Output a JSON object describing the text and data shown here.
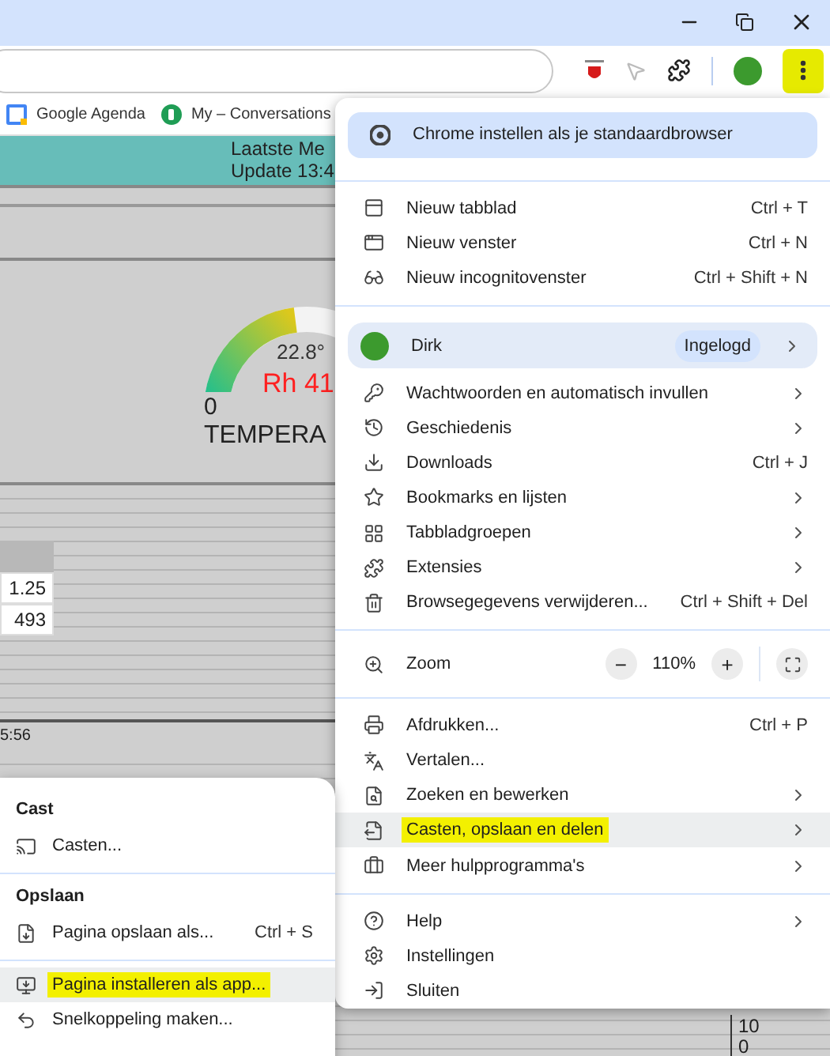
{
  "toolbar": {
    "menu_button": {
      "highlighted": true
    }
  },
  "bookmarks": [
    {
      "label": "Google Agenda"
    },
    {
      "label": "My – Conversations"
    }
  ],
  "page": {
    "header": [
      "Laatste Me",
      "Update 13:4"
    ],
    "gauge": {
      "value": "22.8°",
      "humidity": "Rh 41",
      "min": "0",
      "label": "TEMPERA",
      "level": 0.46
    },
    "table": {
      "rows": [
        [
          "1.25"
        ],
        [
          "493"
        ]
      ]
    },
    "time_label": "5:56",
    "axis_ticks": [
      "10",
      "0"
    ]
  },
  "menu": {
    "banner": "Chrome instellen als je standaardbrowser",
    "sections": [
      [
        {
          "kind": "item",
          "label": "Nieuw tabblad",
          "shortcut": "Ctrl + T",
          "submenu": false,
          "selected": false,
          "highlighted": false
        },
        {
          "kind": "item",
          "label": "Nieuw venster",
          "shortcut": "Ctrl + N",
          "submenu": false,
          "selected": false,
          "highlighted": false
        },
        {
          "kind": "item",
          "label": "Nieuw incognitovenster",
          "shortcut": "Ctrl + Shift + N",
          "submenu": false,
          "selected": false,
          "highlighted": false
        }
      ],
      [
        {
          "kind": "profile",
          "label": "Dirk",
          "badge": "Ingelogd",
          "submenu": true,
          "selected": false,
          "highlighted": false
        },
        {
          "kind": "item",
          "label": "Wachtwoorden en automatisch invullen",
          "submenu": true,
          "selected": false,
          "highlighted": false
        },
        {
          "kind": "item",
          "label": "Geschiedenis",
          "submenu": true,
          "selected": false,
          "highlighted": false
        },
        {
          "kind": "item",
          "label": "Downloads",
          "shortcut": "Ctrl + J",
          "submenu": false,
          "selected": false,
          "highlighted": false
        },
        {
          "kind": "item",
          "label": "Bookmarks en lijsten",
          "submenu": true,
          "selected": false,
          "highlighted": false
        },
        {
          "kind": "item",
          "label": "Tabbladgroepen",
          "submenu": true,
          "selected": false,
          "highlighted": false
        },
        {
          "kind": "item",
          "label": "Extensies",
          "submenu": true,
          "selected": false,
          "highlighted": false
        },
        {
          "kind": "item",
          "label": "Browsegegevens verwijderen...",
          "shortcut": "Ctrl + Shift + Del",
          "submenu": false,
          "selected": false,
          "highlighted": false
        }
      ],
      [
        {
          "kind": "zoom",
          "label": "Zoom",
          "value": "110%",
          "minus": "−",
          "plus": "+",
          "selected": false,
          "highlighted": false
        }
      ],
      [
        {
          "kind": "item",
          "label": "Afdrukken...",
          "shortcut": "Ctrl + P",
          "submenu": false,
          "selected": false,
          "highlighted": false
        },
        {
          "kind": "item",
          "label": "Vertalen...",
          "submenu": false,
          "selected": false,
          "highlighted": false
        },
        {
          "kind": "item",
          "label": "Zoeken en bewerken",
          "submenu": true,
          "selected": false,
          "highlighted": false
        },
        {
          "kind": "item",
          "label": "Casten, opslaan en delen",
          "submenu": true,
          "selected": true,
          "highlighted": true
        },
        {
          "kind": "item",
          "label": "Meer hulpprogramma's",
          "submenu": true,
          "selected": false,
          "highlighted": false
        }
      ],
      [
        {
          "kind": "item",
          "label": "Help",
          "submenu": true,
          "selected": false,
          "highlighted": false
        },
        {
          "kind": "item",
          "label": "Instellingen",
          "submenu": false,
          "selected": false,
          "highlighted": false
        },
        {
          "kind": "item",
          "label": "Sluiten",
          "submenu": false,
          "selected": false,
          "highlighted": false
        }
      ]
    ]
  },
  "submenu": {
    "sections": [
      {
        "heading": "Cast",
        "items": [
          {
            "label": "Casten...",
            "selected": false,
            "highlighted": false
          }
        ]
      },
      {
        "heading": "Opslaan",
        "items": [
          {
            "label": "Pagina opslaan als...",
            "shortcut": "Ctrl + S",
            "selected": false,
            "highlighted": false
          }
        ]
      },
      {
        "items": [
          {
            "label": "Pagina installeren als app...",
            "selected": true,
            "highlighted": true
          },
          {
            "label": "Snelkoppeling maken...",
            "selected": false,
            "highlighted": false
          }
        ]
      }
    ]
  }
}
